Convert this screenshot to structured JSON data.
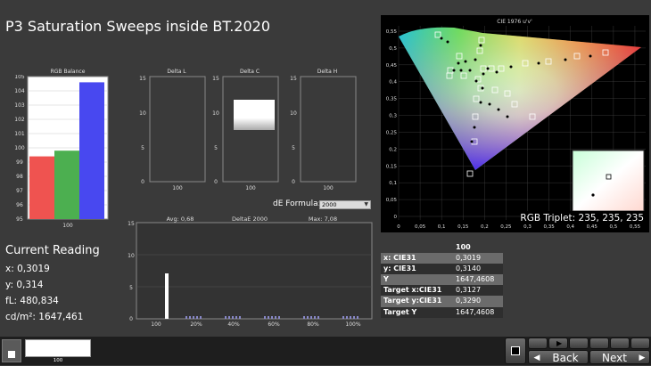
{
  "title": "P3 Saturation Sweeps inside BT.2020",
  "rgb_balance": {
    "label": "RGB Balance",
    "y_ticks": [
      "105",
      "104",
      "103",
      "102",
      "101",
      "100",
      "99",
      "98",
      "97",
      "96",
      "95"
    ],
    "ylim": [
      95,
      105
    ],
    "x_label": "100",
    "bars": [
      {
        "name": "R",
        "value": 99.4,
        "color": "#ef5350"
      },
      {
        "name": "G",
        "value": 99.8,
        "color": "#4caf50"
      },
      {
        "name": "B",
        "value": 104.6,
        "color": "#4848f0"
      }
    ]
  },
  "delta_l": {
    "label": "Delta L",
    "x_label": "100",
    "y_ticks": [
      "15",
      "10",
      "5",
      "0"
    ]
  },
  "delta_c": {
    "label": "Delta C",
    "x_label": "100",
    "y_ticks": [
      "15",
      "10",
      "5",
      "0"
    ]
  },
  "delta_h": {
    "label": "Delta H",
    "x_label": "100",
    "y_ticks": [
      "15",
      "10",
      "5",
      "0"
    ]
  },
  "de_formula": {
    "label": "dE Formula:",
    "value": "2000"
  },
  "deltae": {
    "title": "DeltaE 2000",
    "avg": "Avg: 0,68",
    "max": "Max: 7,08",
    "y_ticks": [
      "15",
      "10",
      "5",
      "0"
    ],
    "x_ticks": [
      "100",
      "20%",
      "40%",
      "60%",
      "80%",
      "100%"
    ]
  },
  "current_reading": {
    "title": "Current Reading",
    "x": "x: 0,3019",
    "y": "y: 0,314",
    "fl": "fL: 480,834",
    "cdm2": "cd/m²: 1647,461"
  },
  "cie": {
    "title": "CIE 1976 u'v'",
    "y_ticks": [
      "0,55",
      "0,5",
      "0,45",
      "0,4",
      "0,35",
      "0,3",
      "0,25",
      "0,2",
      "0,15",
      "0,1",
      "0,05",
      "0"
    ],
    "x_ticks": [
      "0",
      "0,05",
      "0,1",
      "0,15",
      "0,2",
      "0,25",
      "0,3",
      "0,35",
      "0,4",
      "0,45",
      "0,5",
      "0,55"
    ],
    "rgb_triplet": "RGB Triplet: 235, 235, 235"
  },
  "table": {
    "header": "100",
    "rows": [
      {
        "label": "x: CIE31",
        "value": "0,3019"
      },
      {
        "label": "y: CIE31",
        "value": "0,3140"
      },
      {
        "label": "Y",
        "value": "1647,4608"
      },
      {
        "label": "Target x:CIE31",
        "value": "0,3127"
      },
      {
        "label": "Target y:CIE31",
        "value": "0,3290"
      },
      {
        "label": "Target Y",
        "value": "1647,4608"
      }
    ]
  },
  "bottom": {
    "swatch_label": "100",
    "back": "Back",
    "next": "Next"
  },
  "colors": {
    "background": "#3a3a3a",
    "bar_bg": "#ffffff",
    "deltae_bar": "#ffffff"
  }
}
